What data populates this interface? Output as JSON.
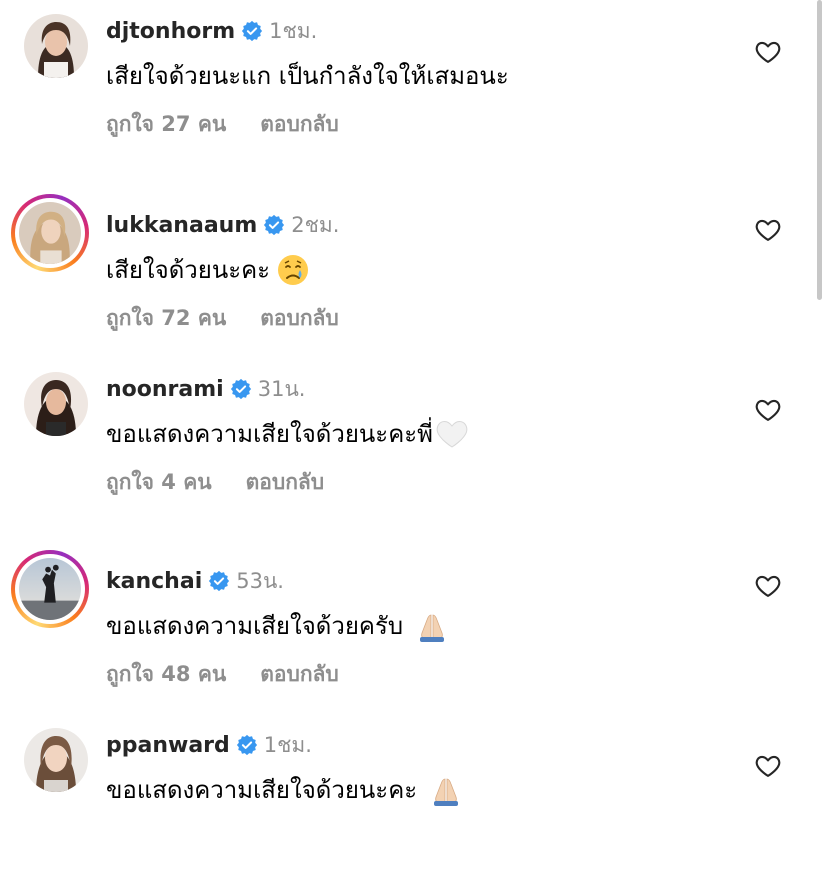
{
  "comments": [
    {
      "username": "djtonhorm",
      "time": "1ชม.",
      "text": "เสียใจด้วยนะแก เป็นกำลังใจให้เสมอนะ",
      "emoji": "",
      "likes": "ถูกใจ 27 คน",
      "reply": "ตอบกลับ",
      "story_ring": false,
      "avatar": "woman-portrait-avatar"
    },
    {
      "username": "lukkanaaum",
      "time": "2ชม.",
      "text": "เสียใจด้วยนะคะ",
      "emoji": "crying-face-emoji",
      "likes": "ถูกใจ 72 คน",
      "reply": "ตอบกลับ",
      "story_ring": true,
      "avatar": "woman-portrait-avatar"
    },
    {
      "username": "noonrami",
      "time": "31น.",
      "text": "ขอแสดงความเสียใจด้วยนะคะพี่",
      "emoji": "white-heart-emoji",
      "likes": "ถูกใจ 4 คน",
      "reply": "ตอบกลับ",
      "story_ring": false,
      "avatar": "woman-portrait-avatar"
    },
    {
      "username": "kanchai",
      "time": "53น.",
      "text": "ขอแสดงความเสียใจด้วยครับ",
      "emoji": "folded-hands-emoji",
      "likes": "ถูกใจ 48 คน",
      "reply": "ตอบกลับ",
      "story_ring": true,
      "avatar": "silhouette-sunset-avatar"
    },
    {
      "username": "ppanward",
      "time": "1ชม.",
      "text": "ขอแสดงความเสียใจด้วยนะคะ",
      "emoji": "folded-hands-emoji",
      "likes": "",
      "reply": "",
      "story_ring": false,
      "avatar": "woman-portrait-avatar"
    }
  ],
  "colors": {
    "username": "#262626",
    "meta": "#8e8e8e",
    "verified": "#3897f0",
    "heart_outline": "#262626",
    "story_ring_start": "#feda75",
    "story_ring_end": "#962fbf"
  }
}
